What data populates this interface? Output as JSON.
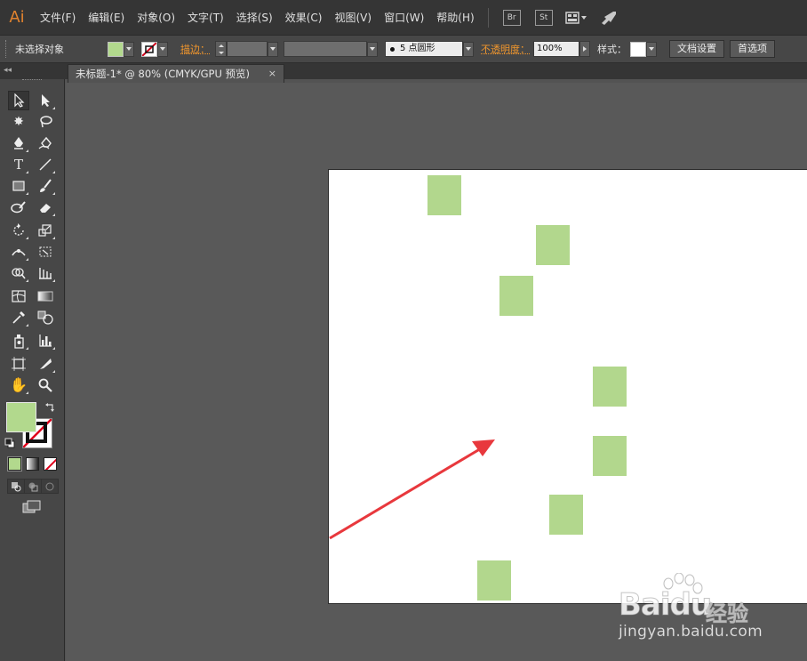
{
  "app": {
    "logo": "Ai"
  },
  "menu": {
    "items": [
      "文件(F)",
      "编辑(E)",
      "对象(O)",
      "文字(T)",
      "选择(S)",
      "效果(C)",
      "视图(V)",
      "窗口(W)",
      "帮助(H)"
    ],
    "bridge_label": "Br",
    "stock_label": "St"
  },
  "control": {
    "selection_status": "未选择对象",
    "stroke_label": "描边：",
    "brush_label": "5 点圆形",
    "opacity_label": "不透明度：",
    "opacity_value": "100%",
    "style_label": "样式：",
    "doc_setup_button": "文档设置",
    "preferences_button": "首选项"
  },
  "document": {
    "tab_title": "未标题-1* @ 80% (CMYK/GPU 预览)",
    "close_glyph": "×"
  },
  "colors": {
    "fill": "#b2d98d",
    "arrow": "#e8383d",
    "accent": "#e2832e"
  },
  "watermark": {
    "logo": "Baidu",
    "brand_cn": "经验",
    "url": "jingyan.baidu.com"
  },
  "tools": [
    "selection-tool",
    "direct-selection-tool",
    "magic-wand-tool",
    "lasso-tool",
    "pen-tool",
    "curvature-pen-tool",
    "type-tool",
    "line-segment-tool",
    "rectangle-tool",
    "paintbrush-tool",
    "blob-brush-tool",
    "eraser-tool",
    "rotate-tool",
    "scale-tool",
    "width-tool",
    "free-transform-tool",
    "shape-builder-tool",
    "perspective-grid-tool",
    "mesh-tool",
    "gradient-tool",
    "eyedropper-tool",
    "blend-tool",
    "symbol-sprayer-tool",
    "column-graph-tool",
    "artboard-tool",
    "slice-tool",
    "hand-tool",
    "zoom-tool"
  ]
}
